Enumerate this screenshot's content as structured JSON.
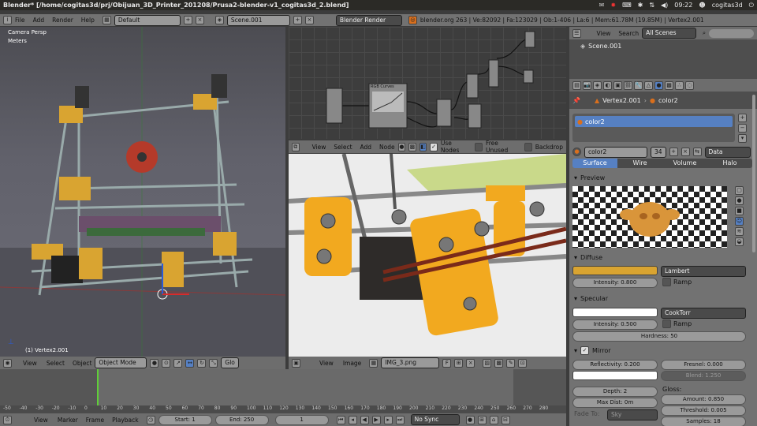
{
  "os": {
    "title": "Blender* [/home/cogitas3d/prj/Obijuan_3D_Printer_201208/Prusa2-blender-v1_cogitas3d_2.blend]",
    "time": "09:22",
    "user": "cogitas3d"
  },
  "topbar": {
    "menus": [
      "File",
      "Add",
      "Render",
      "Help"
    ],
    "layout": "Default",
    "scene": "Scene.001",
    "engine": "Blender Render",
    "stats": "blender.org 263 | Ve:82092 | Fa:123029 | Ob:1-406 | La:6 | Mem:61.78M (19.85M) | Vertex2.001"
  },
  "viewport": {
    "view_name": "Camera Persp",
    "units": "Meters",
    "selected": "(1) Vertex2.001",
    "header": {
      "menus": [
        "View",
        "Select",
        "Object"
      ],
      "mode": "Object Mode",
      "orientation": "Glo"
    }
  },
  "node_editor": {
    "menus": [
      "View",
      "Select",
      "Add",
      "Node"
    ],
    "use_nodes": "Use Nodes",
    "free_unused": "Free Unused",
    "backdrop": "Backdrop",
    "node_title": "RGB Curves"
  },
  "image_editor": {
    "menus": [
      "View",
      "Image"
    ],
    "image": "IMG_3.png",
    "flag": "F"
  },
  "timeline": {
    "ticks": [
      "-50",
      "-40",
      "-30",
      "-20",
      "-10",
      "0",
      "10",
      "20",
      "30",
      "40",
      "50",
      "60",
      "70",
      "80",
      "90",
      "100",
      "110",
      "120",
      "130",
      "140",
      "150",
      "160",
      "170",
      "180",
      "190",
      "200",
      "210",
      "220",
      "230",
      "240",
      "250",
      "260",
      "270",
      "280"
    ],
    "menus": [
      "View",
      "Marker",
      "Frame",
      "Playback"
    ],
    "start": "Start: 1",
    "end": "End: 250",
    "current": "1",
    "sync": "No Sync"
  },
  "outliner": {
    "menus": [
      "View",
      "Search"
    ],
    "filter": "All Scenes",
    "scene_item": "Scene.001"
  },
  "properties": {
    "breadcrumb": [
      "Vertex2.001",
      "color2"
    ],
    "material_slot": "color2",
    "material_name": "color2",
    "users": "34",
    "link": "Data",
    "tabs": [
      "Surface",
      "Wire",
      "Volume",
      "Halo"
    ],
    "preview_label": "Preview",
    "diffuse": {
      "label": "Diffuse",
      "shader": "Lambert",
      "intensity": "Intensity: 0.800",
      "ramp": "Ramp",
      "color": "#d9a431"
    },
    "specular": {
      "label": "Specular",
      "shader": "CookTorr",
      "intensity": "Intensity: 0.500",
      "ramp": "Ramp",
      "hardness": "Hardness: 50",
      "color": "#ffffff"
    },
    "mirror": {
      "label": "Mirror",
      "reflectivity": "Reflectivity: 0.200",
      "fresnel": "Fresnel: 0.000",
      "blend": "Blend: 1.250",
      "depth": "Depth: 2",
      "maxdist": "Max Dist: 0m",
      "gloss": "Gloss:",
      "amount": "Amount: 0.850",
      "threshold": "Threshold: 0.005",
      "samples": "Samples: 18",
      "fadeto": "Fade To:",
      "sky": "Sky"
    }
  }
}
